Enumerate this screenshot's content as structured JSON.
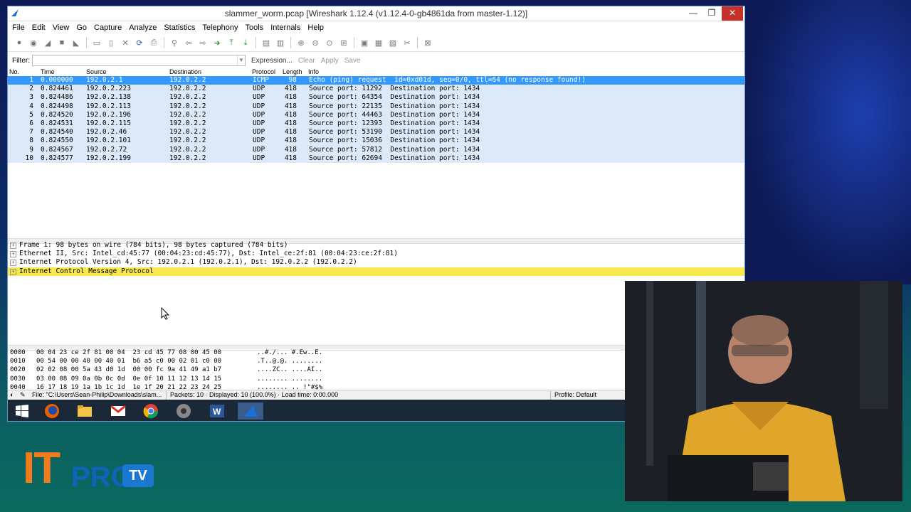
{
  "window": {
    "title": "slammer_worm.pcap   [Wireshark 1.12.4  (v1.12.4-0-gb4861da from master-1.12)]",
    "controls": {
      "minimize": "—",
      "maximize": "❐",
      "close": "✕"
    }
  },
  "menu": [
    "File",
    "Edit",
    "View",
    "Go",
    "Capture",
    "Analyze",
    "Statistics",
    "Telephony",
    "Tools",
    "Internals",
    "Help"
  ],
  "filter": {
    "label": "Filter:",
    "value": "",
    "expression": "Expression...",
    "clear": "Clear",
    "apply": "Apply",
    "save": "Save"
  },
  "packet_list": {
    "columns": [
      "No.",
      "Time",
      "Source",
      "Destination",
      "Protocol",
      "Length",
      "Info"
    ],
    "rows": [
      {
        "no": "1",
        "time": "0.000000",
        "src": "192.0.2.1",
        "dst": "192.0.2.2",
        "proto": "ICMP",
        "len": "98",
        "info": "Echo (ping) request  id=0xd01d, seq=0/0, ttl=64 (no response found!)"
      },
      {
        "no": "2",
        "time": "0.824461",
        "src": "192.0.2.223",
        "dst": "192.0.2.2",
        "proto": "UDP",
        "len": "418",
        "info": "Source port: 11292  Destination port: 1434"
      },
      {
        "no": "3",
        "time": "0.824486",
        "src": "192.0.2.138",
        "dst": "192.0.2.2",
        "proto": "UDP",
        "len": "418",
        "info": "Source port: 64354  Destination port: 1434"
      },
      {
        "no": "4",
        "time": "0.824498",
        "src": "192.0.2.113",
        "dst": "192.0.2.2",
        "proto": "UDP",
        "len": "418",
        "info": "Source port: 22135  Destination port: 1434"
      },
      {
        "no": "5",
        "time": "0.824520",
        "src": "192.0.2.196",
        "dst": "192.0.2.2",
        "proto": "UDP",
        "len": "418",
        "info": "Source port: 44463  Destination port: 1434"
      },
      {
        "no": "6",
        "time": "0.824531",
        "src": "192.0.2.115",
        "dst": "192.0.2.2",
        "proto": "UDP",
        "len": "418",
        "info": "Source port: 12393  Destination port: 1434"
      },
      {
        "no": "7",
        "time": "0.824540",
        "src": "192.0.2.46",
        "dst": "192.0.2.2",
        "proto": "UDP",
        "len": "418",
        "info": "Source port: 53190  Destination port: 1434"
      },
      {
        "no": "8",
        "time": "0.824550",
        "src": "192.0.2.101",
        "dst": "192.0.2.2",
        "proto": "UDP",
        "len": "418",
        "info": "Source port: 15036  Destination port: 1434"
      },
      {
        "no": "9",
        "time": "0.824567",
        "src": "192.0.2.72",
        "dst": "192.0.2.2",
        "proto": "UDP",
        "len": "418",
        "info": "Source port: 57812  Destination port: 1434"
      },
      {
        "no": "10",
        "time": "0.824577",
        "src": "192.0.2.199",
        "dst": "192.0.2.2",
        "proto": "UDP",
        "len": "418",
        "info": "Source port: 62694  Destination port: 1434"
      }
    ]
  },
  "details": [
    "Frame 1: 98 bytes on wire (784 bits), 98 bytes captured (784 bits)",
    "Ethernet II, Src: Intel_cd:45:77 (00:04:23:cd:45:77), Dst: Intel_ce:2f:81 (00:04:23:ce:2f:81)",
    "Internet Protocol Version 4, Src: 192.0.2.1 (192.0.2.1), Dst: 192.0.2.2 (192.0.2.2)",
    "Internet Control Message Protocol"
  ],
  "hex": [
    {
      "off": "0000",
      "bytes": "00 04 23 ce 2f 81 00 04  23 cd 45 77 08 00 45 00",
      "ascii": "..#./... #.Ew..E."
    },
    {
      "off": "0010",
      "bytes": "00 54 00 00 40 00 40 01  b6 a5 c0 00 02 01 c0 00",
      "ascii": ".T..@.@. ........"
    },
    {
      "off": "0020",
      "bytes": "02 02 08 00 5a 43 d0 1d  00 00 fc 9a 41 49 a1 b7",
      "ascii": "....ZC.. ....AI.."
    },
    {
      "off": "0030",
      "bytes": "03 00 08 09 0a 0b 0c 0d  0e 0f 10 11 12 13 14 15",
      "ascii": "........ ........"
    },
    {
      "off": "0040",
      "bytes": "16 17 18 19 1a 1b 1c 1d  1e 1f 20 21 22 23 24 25",
      "ascii": "........ .. !\"#$%"
    }
  ],
  "status": {
    "file": "File: \"C:\\Users\\Sean-Philip\\Downloads\\slam...",
    "packets": "Packets: 10 · Displayed: 10 (100.0%) · Load time: 0:00.000",
    "profile": "Profile: Default"
  },
  "logo": {
    "it": "IT",
    "pro": "PRO",
    "tv": "TV"
  },
  "colors": {
    "selected": "#3399ff",
    "row": "#dbe9f9",
    "highlight": "#f7e84b",
    "close": "#c7312c",
    "orange": "#f07b1b"
  }
}
